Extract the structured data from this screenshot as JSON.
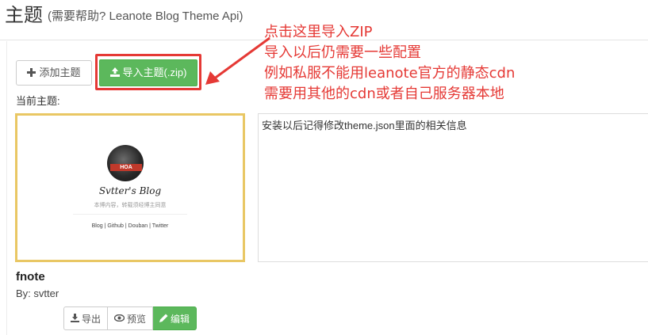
{
  "header": {
    "title": "主题",
    "subtitle": "(需要帮助? Leanote Blog Theme Api)"
  },
  "toolbar": {
    "add_label": "添加主题",
    "import_label": "导入主题(.zip)"
  },
  "current_label": "当前主题:",
  "theme": {
    "preview": {
      "avatar_tag": "HOA",
      "blog_name": "Svtter's Blog",
      "description": "本博内容，转载须经博主同意",
      "links": "Blog | Github | Douban | Twitter"
    },
    "name": "fnote",
    "author": "By: svtter",
    "info": "安装以后记得修改theme.json里面的相关信息",
    "actions": {
      "export_label": "导出",
      "preview_label": "预览",
      "edit_label": "编辑"
    }
  },
  "annotation": {
    "line1": "点击这里导入ZIP",
    "line2": "导入以后仍需要一些配置",
    "line3": "例如私服不能用leanote官方的静态cdn",
    "line4": "需要用其他的cdn或者自己服务器本地"
  },
  "colors": {
    "success": "#5cb85c",
    "annotation_red": "#e53935",
    "card_border": "#e9c764"
  },
  "icons": {
    "add": "plus-icon",
    "import": "upload-icon",
    "export": "download-icon",
    "preview": "eye-icon",
    "edit": "pencil-icon"
  }
}
